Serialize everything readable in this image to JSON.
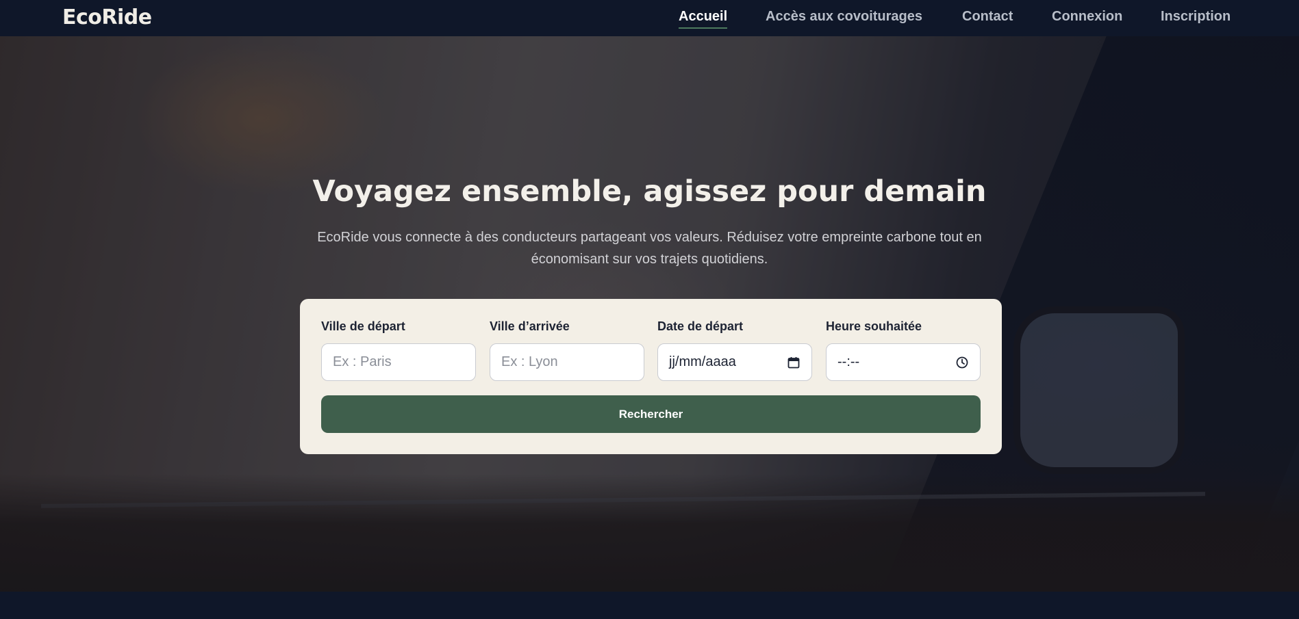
{
  "brand": {
    "name": "EcoRide"
  },
  "nav": {
    "items": [
      {
        "label": "Accueil",
        "active": true
      },
      {
        "label": "Accès aux covoiturages",
        "active": false
      },
      {
        "label": "Contact",
        "active": false
      },
      {
        "label": "Connexion",
        "active": false
      },
      {
        "label": "Inscription",
        "active": false
      }
    ]
  },
  "hero": {
    "title": "Voyagez ensemble, agissez pour demain",
    "subtitle": "EcoRide vous connecte à des conducteurs partageant vos valeurs. Réduisez votre empreinte carbone tout en économisant sur vos trajets quotidiens."
  },
  "search": {
    "departure": {
      "label": "Ville de départ",
      "placeholder": "Ex : Paris",
      "value": ""
    },
    "arrival": {
      "label": "Ville d’arrivée",
      "placeholder": "Ex : Lyon",
      "value": ""
    },
    "date": {
      "label": "Date de départ",
      "display": "jj/mm/aaaa",
      "icon": "calendar-icon"
    },
    "time": {
      "label": "Heure souhaitée",
      "display": "--:--",
      "icon": "clock-icon"
    },
    "submit_label": "Rechercher"
  },
  "colors": {
    "navbar": "#0f1729",
    "card": "#f3efe6",
    "button": "#3f5f4c",
    "active_underline": "#4d7a5e"
  }
}
